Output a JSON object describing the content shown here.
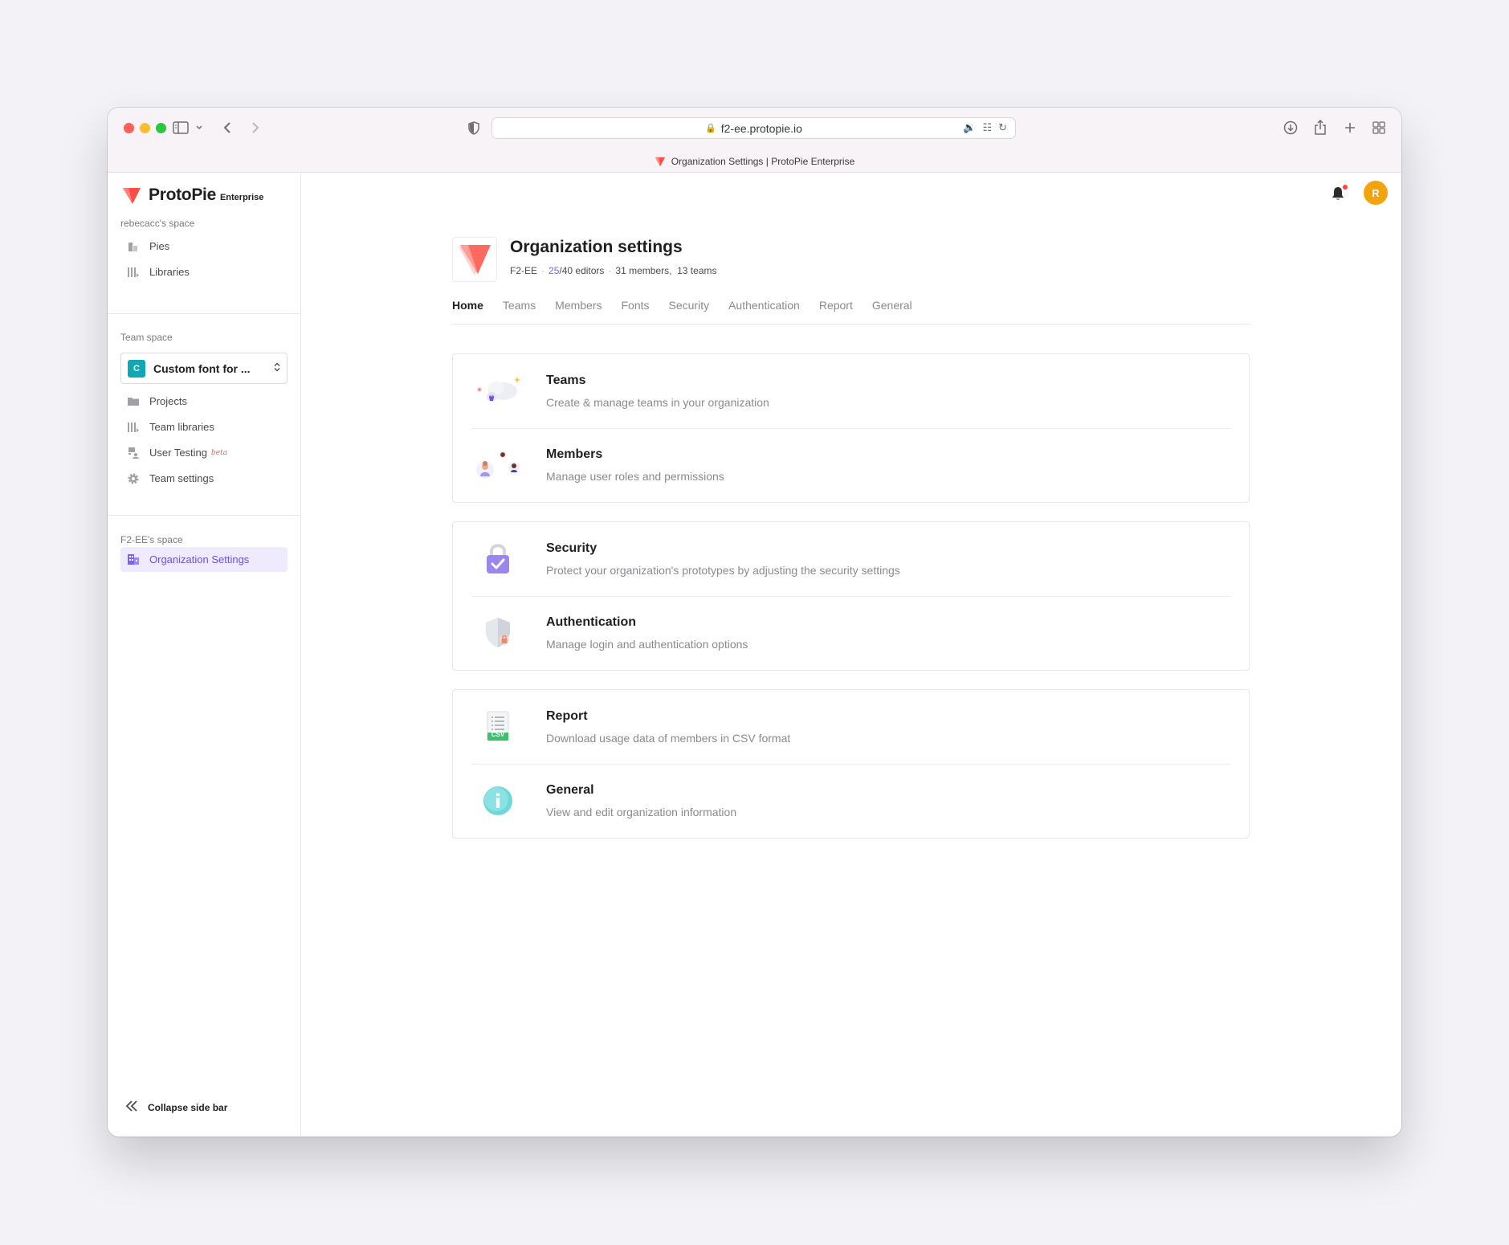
{
  "browser": {
    "url": "f2-ee.protopie.io",
    "tab_title": "Organization Settings | ProtoPie Enterprise"
  },
  "sidebar": {
    "brand_name": "ProtoPie",
    "brand_sub": "Enterprise",
    "personal_space_label": "rebecacc's space",
    "personal_items": [
      {
        "label": "Pies",
        "icon": "pies-icon"
      },
      {
        "label": "Libraries",
        "icon": "libraries-icon"
      }
    ],
    "team_space_label": "Team space",
    "team_select": {
      "badge": "C",
      "name": "Custom font for ..."
    },
    "team_items": [
      {
        "label": "Projects",
        "icon": "folder-icon"
      },
      {
        "label": "Team libraries",
        "icon": "libraries-icon"
      },
      {
        "label": "User Testing",
        "icon": "user-testing-icon",
        "badge": "beta"
      },
      {
        "label": "Team settings",
        "icon": "gear-icon"
      }
    ],
    "org_space_label": "F2-EE's space",
    "org_item": {
      "label": "Organization Settings",
      "icon": "building-icon",
      "active": true
    },
    "collapse_label": "Collapse side bar"
  },
  "header": {
    "avatar_initial": "R"
  },
  "org": {
    "title": "Organization settings",
    "code": "F2-EE",
    "editors_used": "25",
    "editors_total": "/40 editors",
    "members": "31 members,",
    "teams": "13 teams"
  },
  "tabs": [
    {
      "label": "Home",
      "active": true
    },
    {
      "label": "Teams"
    },
    {
      "label": "Members"
    },
    {
      "label": "Fonts"
    },
    {
      "label": "Security"
    },
    {
      "label": "Authentication"
    },
    {
      "label": "Report"
    },
    {
      "label": "General"
    }
  ],
  "cards": [
    [
      {
        "title": "Teams",
        "desc": "Create & manage teams in your organization",
        "icon": "teams-illustration-icon"
      },
      {
        "title": "Members",
        "desc": "Manage user roles and permissions",
        "icon": "members-illustration-icon"
      }
    ],
    [
      {
        "title": "Security",
        "desc": "Protect your organization's prototypes by adjusting the security settings",
        "icon": "padlock-icon"
      },
      {
        "title": "Authentication",
        "desc": "Manage login and authentication options",
        "icon": "shield-icon"
      }
    ],
    [
      {
        "title": "Report",
        "desc": "Download usage data of members in CSV format",
        "icon": "csv-report-icon",
        "icon_text": "CSV"
      },
      {
        "title": "General",
        "desc": "View and edit organization information",
        "icon": "info-icon",
        "icon_text": "i"
      }
    ]
  ],
  "colors": {
    "accent": "#7d64e6",
    "brand": "#ff4e45",
    "avatar": "#f5a30c",
    "team_badge": "#11a7b5"
  }
}
